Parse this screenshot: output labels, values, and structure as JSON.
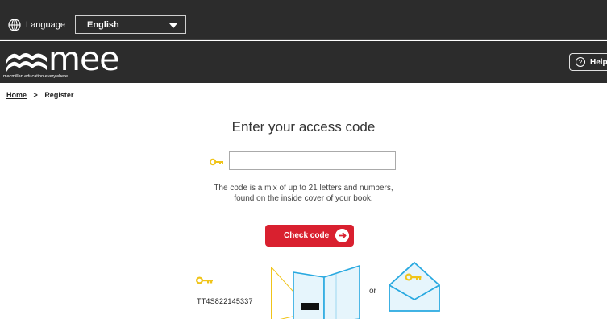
{
  "language_bar": {
    "label": "Language",
    "selected_language": "English",
    "icon": "globe-icon"
  },
  "brand": {
    "logo_text": "mee",
    "tagline": "macmillan education everywhere",
    "help_label": "Help",
    "help_icon_text": "?"
  },
  "breadcrumb": {
    "home": "Home",
    "separator": ">",
    "current": "Register"
  },
  "main": {
    "title": "Enter your access code",
    "access_code_value": "",
    "access_code_placeholder": "",
    "hint_line1": "The code is a mix of up to 21 letters and numbers,",
    "hint_line2": "found on the inside cover of your book.",
    "check_button_label": "Check code"
  },
  "illustration": {
    "sample_code": "TT4S822145337",
    "or_text": "or"
  },
  "colors": {
    "header_bg": "#2c2c2c",
    "accent_red": "#d9202f",
    "key_yellow": "#f0c419",
    "book_blue": "#29a9e0"
  }
}
